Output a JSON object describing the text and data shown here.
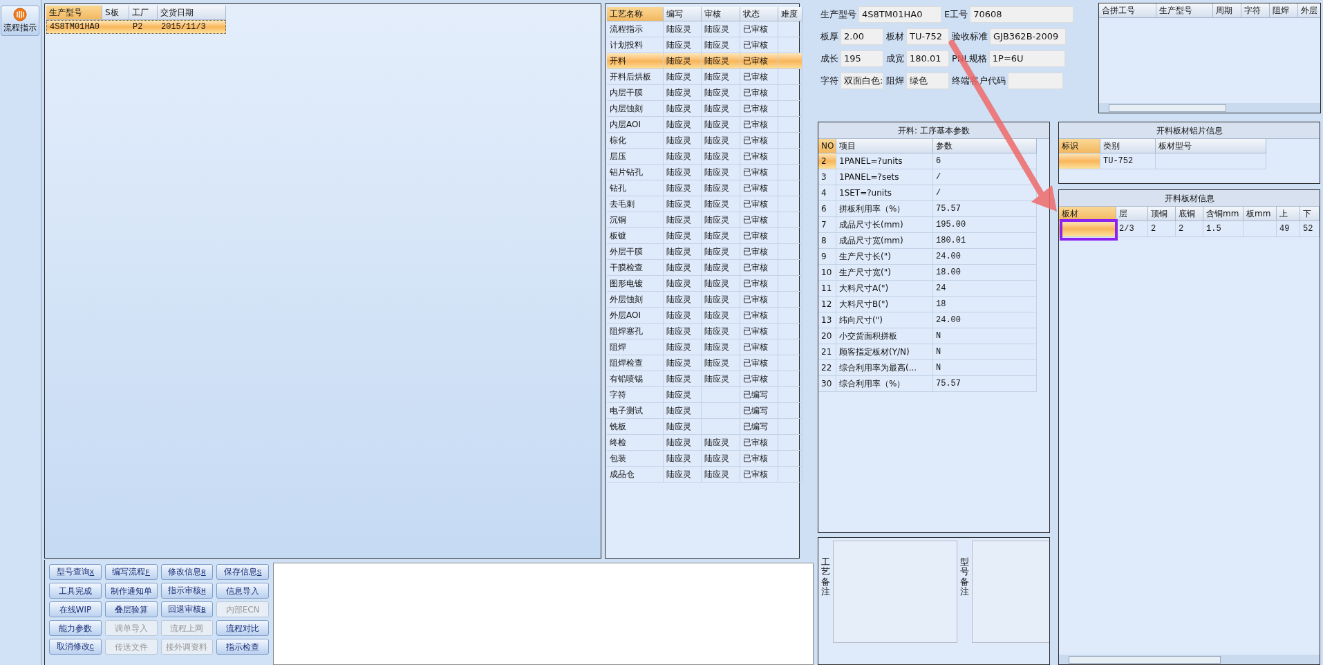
{
  "sidebar": {
    "label": "流程指示"
  },
  "orders": {
    "columns": [
      "生产型号",
      "S板",
      "工厂",
      "交货日期"
    ],
    "rows": [
      {
        "cells": [
          "4S8TM01HA0",
          "",
          "P2",
          "2015/11/3"
        ],
        "selected": true
      }
    ]
  },
  "processes": {
    "columns": [
      "工艺名称",
      "编写",
      "审核",
      "状态",
      "难度"
    ],
    "rows": [
      {
        "name": "流程指示",
        "writer": "陆应灵",
        "reviewer": "陆应灵",
        "status": "已审核",
        "selected": false
      },
      {
        "name": "计划投料",
        "writer": "陆应灵",
        "reviewer": "陆应灵",
        "status": "已审核",
        "selected": false
      },
      {
        "name": "开料",
        "writer": "陆应灵",
        "reviewer": "陆应灵",
        "status": "已审核",
        "selected": true
      },
      {
        "name": "开料后烘板",
        "writer": "陆应灵",
        "reviewer": "陆应灵",
        "status": "已审核",
        "selected": false
      },
      {
        "name": "内层干膜",
        "writer": "陆应灵",
        "reviewer": "陆应灵",
        "status": "已审核",
        "selected": false
      },
      {
        "name": "内层蚀刻",
        "writer": "陆应灵",
        "reviewer": "陆应灵",
        "status": "已审核",
        "selected": false
      },
      {
        "name": "内层AOI",
        "writer": "陆应灵",
        "reviewer": "陆应灵",
        "status": "已审核",
        "selected": false
      },
      {
        "name": "棕化",
        "writer": "陆应灵",
        "reviewer": "陆应灵",
        "status": "已审核",
        "selected": false
      },
      {
        "name": "层压",
        "writer": "陆应灵",
        "reviewer": "陆应灵",
        "status": "已审核",
        "selected": false
      },
      {
        "name": "铝片钻孔",
        "writer": "陆应灵",
        "reviewer": "陆应灵",
        "status": "已审核",
        "selected": false
      },
      {
        "name": "钻孔",
        "writer": "陆应灵",
        "reviewer": "陆应灵",
        "status": "已审核",
        "selected": false
      },
      {
        "name": "去毛刺",
        "writer": "陆应灵",
        "reviewer": "陆应灵",
        "status": "已审核",
        "selected": false
      },
      {
        "name": "沉铜",
        "writer": "陆应灵",
        "reviewer": "陆应灵",
        "status": "已审核",
        "selected": false
      },
      {
        "name": "板镀",
        "writer": "陆应灵",
        "reviewer": "陆应灵",
        "status": "已审核",
        "selected": false
      },
      {
        "name": "外层干膜",
        "writer": "陆应灵",
        "reviewer": "陆应灵",
        "status": "已审核",
        "selected": false
      },
      {
        "name": "干膜检查",
        "writer": "陆应灵",
        "reviewer": "陆应灵",
        "status": "已审核",
        "selected": false
      },
      {
        "name": "图形电镀",
        "writer": "陆应灵",
        "reviewer": "陆应灵",
        "status": "已审核",
        "selected": false
      },
      {
        "name": "外层蚀刻",
        "writer": "陆应灵",
        "reviewer": "陆应灵",
        "status": "已审核",
        "selected": false
      },
      {
        "name": "外层AOI",
        "writer": "陆应灵",
        "reviewer": "陆应灵",
        "status": "已审核",
        "selected": false
      },
      {
        "name": "阻焊塞孔",
        "writer": "陆应灵",
        "reviewer": "陆应灵",
        "status": "已审核",
        "selected": false
      },
      {
        "name": "阻焊",
        "writer": "陆应灵",
        "reviewer": "陆应灵",
        "status": "已审核",
        "selected": false
      },
      {
        "name": "阻焊检查",
        "writer": "陆应灵",
        "reviewer": "陆应灵",
        "status": "已审核",
        "selected": false
      },
      {
        "name": "有铅喷锡",
        "writer": "陆应灵",
        "reviewer": "陆应灵",
        "status": "已审核",
        "selected": false
      },
      {
        "name": "字符",
        "writer": "陆应灵",
        "status": "已编写",
        "selected": false
      },
      {
        "name": "电子测试",
        "writer": "陆应灵",
        "status": "已编写",
        "selected": false
      },
      {
        "name": "铣板",
        "writer": "陆应灵",
        "status": "已编写",
        "selected": false
      },
      {
        "name": "终检",
        "writer": "陆应灵",
        "reviewer": "陆应灵",
        "status": "已审核",
        "selected": false
      },
      {
        "name": "包装",
        "writer": "陆应灵",
        "reviewer": "陆应灵",
        "status": "已审核",
        "selected": false
      },
      {
        "name": "成品仓",
        "writer": "陆应灵",
        "reviewer": "陆应灵",
        "status": "已审核",
        "selected": false
      }
    ]
  },
  "buttons": [
    {
      "label": "型号查询",
      "key": "X",
      "disabled": false
    },
    {
      "label": "编写流程",
      "key": "F",
      "disabled": false
    },
    {
      "label": "修改信息",
      "key": "R",
      "disabled": false
    },
    {
      "label": "保存信息",
      "key": "S",
      "disabled": false
    },
    {
      "label": "工具完成",
      "disabled": false
    },
    {
      "label": "制作通知单",
      "disabled": false
    },
    {
      "label": "指示审核",
      "key": "H",
      "disabled": false
    },
    {
      "label": "信息导入",
      "disabled": false
    },
    {
      "label": "在线WIP",
      "disabled": false
    },
    {
      "label": "叠层验算",
      "disabled": false
    },
    {
      "label": "回退审核",
      "key": "B",
      "disabled": false
    },
    {
      "label": "内部ECN",
      "disabled": true
    },
    {
      "label": "能力参数",
      "disabled": false
    },
    {
      "label": "调单导入",
      "disabled": true
    },
    {
      "label": "流程上网",
      "disabled": true
    },
    {
      "label": "流程对比",
      "disabled": false
    },
    {
      "label": "取消修改",
      "key": "C",
      "disabled": false
    },
    {
      "label": "传送文件",
      "disabled": true
    },
    {
      "label": "接外调资料",
      "disabled": true
    },
    {
      "label": "指示检查",
      "disabled": false
    }
  ],
  "info_form": {
    "fields": [
      {
        "label": "生产型号",
        "value": "4S8TM01HA0"
      },
      {
        "label": "E工号",
        "value": "70608"
      },
      {
        "label": "板厚",
        "value": "2.00"
      },
      {
        "label": "板材",
        "value": "TU-752"
      },
      {
        "label": "验收标准",
        "value": "GJB362B-2009"
      },
      {
        "label": "成长",
        "value": "195"
      },
      {
        "label": "成宽",
        "value": "180.01"
      },
      {
        "label": "PNL规格",
        "value": "1P=6U"
      },
      {
        "label": "字符",
        "value": "双面白色:"
      },
      {
        "label": "阻焊",
        "value": "绿色"
      },
      {
        "label": "终端客户代码"
      }
    ]
  },
  "merge_table": {
    "columns": [
      "合拼工号",
      "生产型号",
      "周期",
      "字符",
      "阻焊",
      "外层"
    ]
  },
  "params": {
    "title": "开料: 工序基本参数",
    "columns": [
      "NO",
      "项目",
      "参数"
    ],
    "rows": [
      {
        "no": "2",
        "item": "1PANEL=?units",
        "value": "6",
        "selected": true
      },
      {
        "no": "3",
        "item": "1PANEL=?sets",
        "value": "/",
        "selected": false
      },
      {
        "no": "4",
        "item": "1SET=?units",
        "value": "/",
        "selected": false
      },
      {
        "no": "6",
        "item": "拼板利用率（%）",
        "value": "75.57",
        "selected": false
      },
      {
        "no": "7",
        "item": "成品尺寸长(mm)",
        "value": "195.00",
        "selected": false
      },
      {
        "no": "8",
        "item": "成品尺寸宽(mm)",
        "value": "180.01",
        "selected": false
      },
      {
        "no": "9",
        "item": "生产尺寸长(\")",
        "value": "24.00",
        "selected": false
      },
      {
        "no": "10",
        "item": "生产尺寸宽(\")",
        "value": "18.00",
        "selected": false
      },
      {
        "no": "11",
        "item": "大料尺寸A(\")",
        "value": "24",
        "selected": false
      },
      {
        "no": "12",
        "item": "大料尺寸B(\")",
        "value": "18",
        "selected": false
      },
      {
        "no": "13",
        "item": "纬向尺寸(\")",
        "value": "24.00",
        "selected": false
      },
      {
        "no": "20",
        "item": "小交货面积拼板",
        "value": "N",
        "selected": false
      },
      {
        "no": "21",
        "item": "顾客指定板材(Y/N)",
        "value": "N",
        "selected": false
      },
      {
        "no": "22",
        "item": "综合利用率为最高(...",
        "value": "N",
        "selected": false
      },
      {
        "no": "30",
        "item": "综合利用率（%）",
        "value": "75.57",
        "selected": false
      }
    ]
  },
  "remarks": [
    {
      "label": "工艺备注"
    },
    {
      "label": "型号备注"
    }
  ],
  "foil": {
    "title": "开料板材铝片信息",
    "columns": [
      "标识",
      "类别",
      "板材型号"
    ],
    "rows": [
      {
        "category": "TU-752",
        "selected": true
      }
    ]
  },
  "sheet": {
    "title": "开料板材信息",
    "columns": [
      "板材",
      "层",
      "顶铜",
      "底铜",
      "含铜mm",
      "板mm",
      "上",
      "下"
    ],
    "rows": [
      {
        "cells": [
          "",
          "2/3",
          "2",
          "2",
          "1.5",
          "",
          "49",
          "52"
        ],
        "selected": true
      }
    ]
  }
}
